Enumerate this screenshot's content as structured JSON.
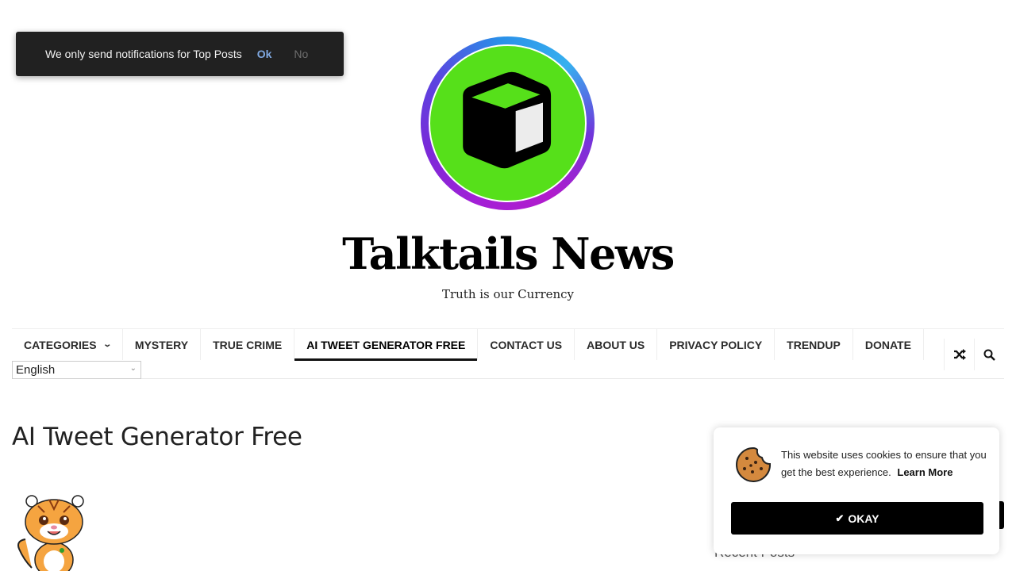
{
  "notification": {
    "message": "We only send notifications for Top Posts",
    "ok_label": "Ok",
    "no_label": "No"
  },
  "site": {
    "title": "Talktails News",
    "tagline": "Truth is our Currency",
    "logo_icon": "cube-icon",
    "colors": {
      "logo_green": "#56e01a",
      "logo_ring_purple": "#a41fd6",
      "logo_ring_blue": "#36b0ef"
    }
  },
  "nav": {
    "items": [
      {
        "label": "CATEGORIES",
        "has_dropdown": true
      },
      {
        "label": "MYSTERY"
      },
      {
        "label": "TRUE CRIME"
      },
      {
        "label": "AI TWEET GENERATOR FREE",
        "active": true
      },
      {
        "label": "CONTACT US"
      },
      {
        "label": "ABOUT US"
      },
      {
        "label": "PRIVACY POLICY"
      },
      {
        "label": "TRENDUP"
      },
      {
        "label": "DONATE"
      }
    ],
    "tools": [
      {
        "icon": "shuffle-icon"
      },
      {
        "icon": "search-icon"
      }
    ],
    "language": {
      "selected": "English"
    }
  },
  "main": {
    "page_title": "AI Tweet Generator Free",
    "image": "tiger-mascot"
  },
  "sidebar": {
    "heading": "Recent Posts"
  },
  "cookie": {
    "message": "This website uses cookies to ensure that you get the best experience.",
    "learn_more": "Learn More",
    "okay_label": "OKAY"
  }
}
